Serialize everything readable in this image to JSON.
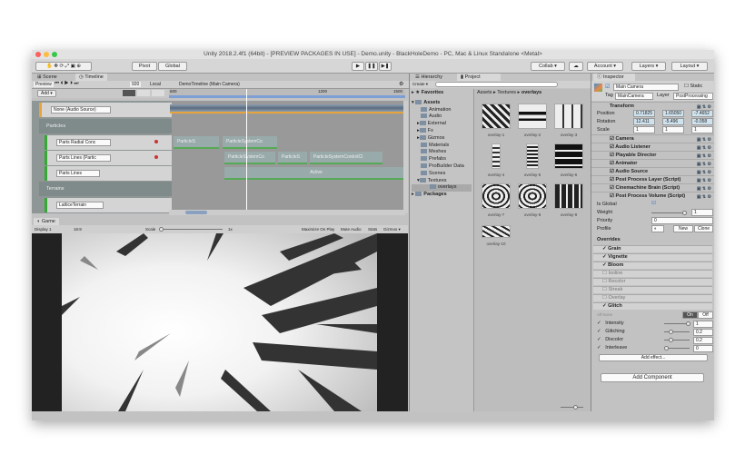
{
  "window": {
    "title": "Unity 2018.2.4f1 (64bit) - [PREVIEW PACKAGES IN USE] - Demo.unity - BlackHoleDemo - PC, Mac & Linux Standalone <Metal>"
  },
  "toolbar": {
    "pivot": "Pivot",
    "global": "Global",
    "collab": "Collab ▾",
    "account": "Account ▾",
    "layers": "Layers ▾",
    "layout": "Layout ▾",
    "play_icon": "play-icon",
    "pause_icon": "pause-icon",
    "step_icon": "step-icon"
  },
  "tabs": {
    "scene": "Scene",
    "timeline": "Timeline",
    "game": "Game",
    "hierarchy": "Hierarchy",
    "project": "Project",
    "inspector": "Inspector"
  },
  "timeline": {
    "preview": "Preview",
    "frame": "920",
    "local": "Local",
    "add": "Add ▾",
    "asset": "DemoTimeline (Main Camera)",
    "ruler": [
      "600",
      "1200",
      "1500"
    ],
    "tracks": [
      {
        "label": "None (Audio Source)"
      },
      {
        "group": "Particles"
      },
      {
        "label": "Parts Radial Conc"
      },
      {
        "label": "Parts Lines (Partic"
      },
      {
        "label": "Parts Lines"
      },
      {
        "group": "Terrains"
      },
      {
        "label": "LatticeTerrain"
      }
    ],
    "clips": {
      "radial": [
        "ParticleS",
        "ParticleSystemCo"
      ],
      "lines": [
        "ParticleSystemCo",
        "ParticleS",
        "ParticleSystemControlCl"
      ],
      "active": "Active"
    }
  },
  "game": {
    "display": "Display 1",
    "aspect": "16:9",
    "scale_label": "Scale",
    "scale": "1x",
    "maximize": "Maximize On Play",
    "mute": "Mute Audio",
    "stats": "Stats",
    "gizmos": "Gizmos ▾"
  },
  "project": {
    "create": "Create ▾",
    "search_placeholder": "",
    "favorites": "Favorites",
    "assets": "Assets",
    "folders": [
      "Animation",
      "Audio",
      "External",
      "Fx",
      "Gizmos",
      "Materials",
      "Meshes",
      "Prefabs",
      "ProBuilder Data",
      "Scenes",
      "Textures"
    ],
    "selected": "overlays",
    "packages": "Packages",
    "breadcrumb": [
      "Assets",
      "Textures",
      "overlays"
    ],
    "items": [
      "overlay-1",
      "overlay-2",
      "overlay-3",
      "overlay-4",
      "overlay-5",
      "overlay-6",
      "overlay-7",
      "overlay-8",
      "overlay-9",
      "overlay-10"
    ]
  },
  "inspector": {
    "name": "Main Camera",
    "static": "Static",
    "tag_label": "Tag",
    "tag": "MainCamera",
    "layer_label": "Layer",
    "layer": "PostProcessing",
    "transform": {
      "title": "Transform",
      "position": {
        "label": "Position",
        "x": "0.71825",
        "y": "1.65050",
        "z": "-7.4652"
      },
      "rotation": {
        "label": "Rotation",
        "x": "12.411",
        "y": "-5.496",
        "z": "-0.058"
      },
      "scale": {
        "label": "Scale",
        "x": "1",
        "y": "1",
        "z": "1"
      }
    },
    "components": [
      "Camera",
      "Audio Listener",
      "Playable Director",
      "Animator",
      "Audio Source",
      "Post Process Layer (Script)",
      "Cinemachine Brain (Script)",
      "Post Process Volume (Script)"
    ],
    "volume": {
      "is_global": "Is Global",
      "weight_label": "Weight",
      "weight": "1",
      "priority_label": "Priority",
      "priority": "0",
      "profile_label": "Profile",
      "new": "New",
      "clone": "Clone"
    },
    "overrides_label": "Overrides",
    "overrides": [
      {
        "name": "Grain",
        "on": true
      },
      {
        "name": "Vignette",
        "on": true
      },
      {
        "name": "Bloom",
        "on": true
      },
      {
        "name": "Isoline",
        "on": false
      },
      {
        "name": "Recolor",
        "on": false
      },
      {
        "name": "Streak",
        "on": false
      },
      {
        "name": "Overlay",
        "on": false
      },
      {
        "name": "Glitch",
        "on": true
      }
    ],
    "glitch": {
      "all": "All",
      "none": "None",
      "on": "On",
      "off": "Off",
      "params": [
        {
          "name": "Intensity",
          "value": "1",
          "level": 1
        },
        {
          "name": "Glitching",
          "value": "0.2",
          "level": 0.2
        },
        {
          "name": "Discolor",
          "value": "0.2",
          "level": 0.2
        },
        {
          "name": "Interleave",
          "value": "0",
          "level": 0
        }
      ]
    },
    "add_effect": "Add effect...",
    "add_component": "Add Component"
  },
  "colors": {
    "accent_green": "#33aa33",
    "selection": "#3d7bd6",
    "game_bg": "#222222"
  }
}
